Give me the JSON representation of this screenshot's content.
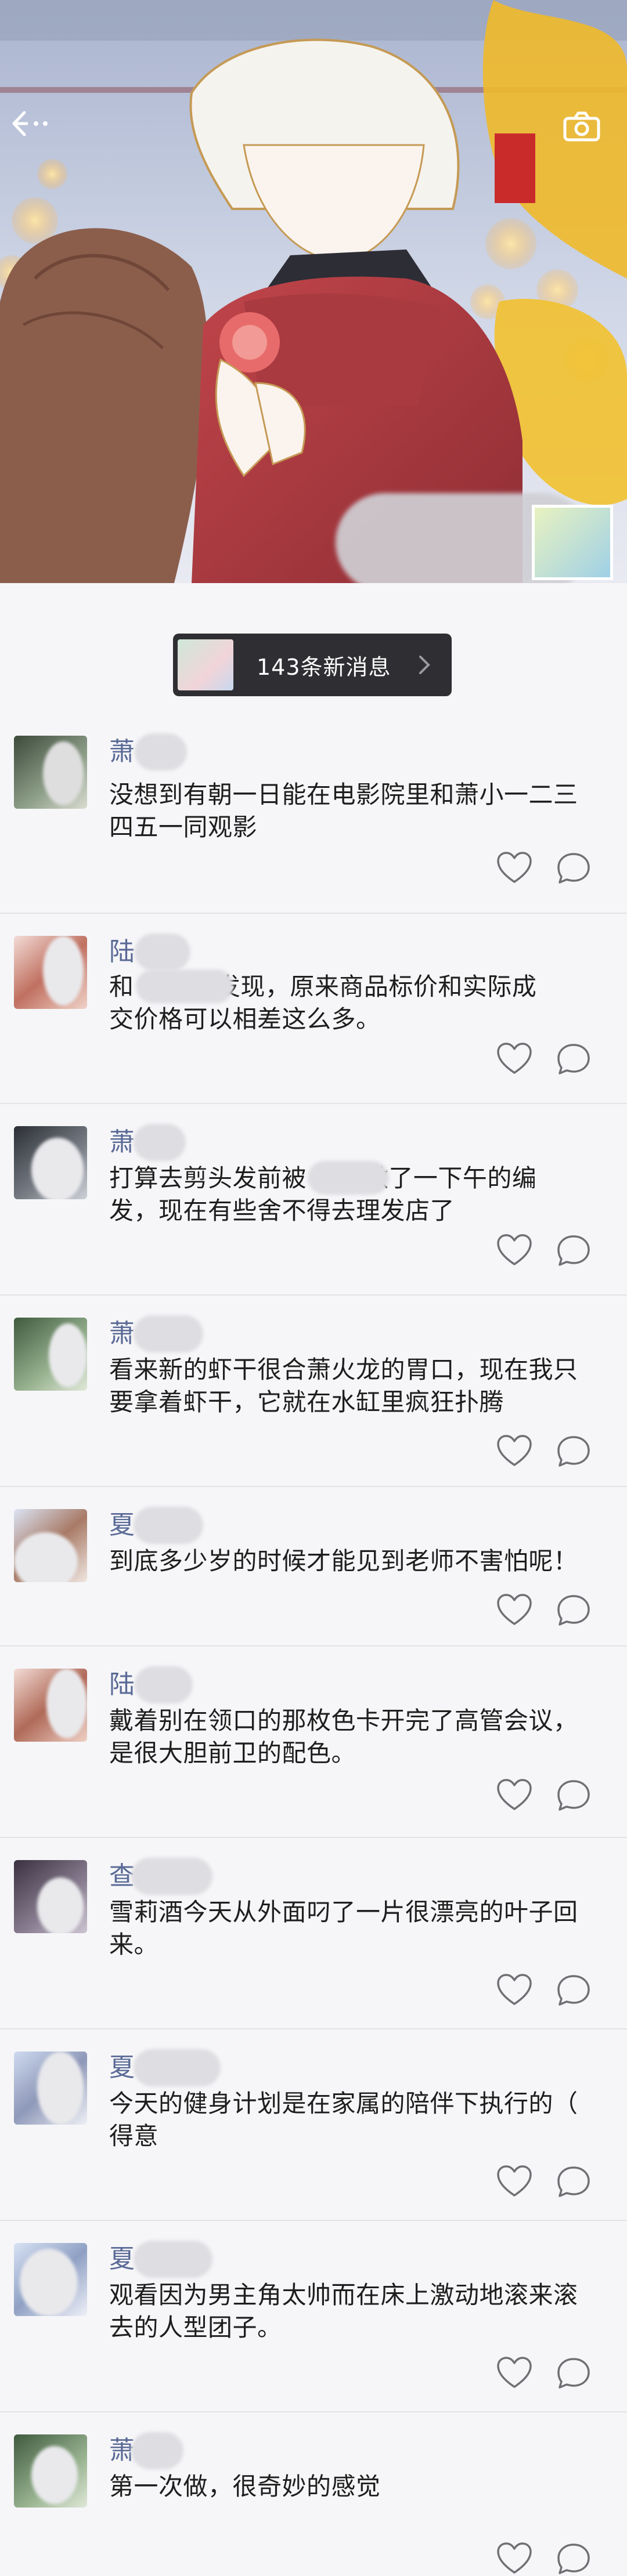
{
  "header": {
    "back_icon": "back-arrow-icon",
    "camera_icon": "camera-icon"
  },
  "new_messages": {
    "label": "143条新消息"
  },
  "posts": [
    {
      "name": "萧",
      "lines": [
        "没想到有朝一日能在电影院里和萧小一二三",
        "四五一同观影"
      ]
    },
    {
      "name": "陆",
      "lines": [
        "和          逛街新发现，原来商品标价和实际成",
        "交价格可以相差这么多。"
      ]
    },
    {
      "name": "萧",
      "lines": [
        "打算去剪头发前被          拉着做了一下午的编",
        "发，现在有些舍不得去理发店了"
      ]
    },
    {
      "name": "萧",
      "lines": [
        "看来新的虾干很合萧火龙的胃口，现在我只",
        "要拿着虾干，它就在水缸里疯狂扑腾"
      ]
    },
    {
      "name": "夏",
      "lines": [
        "到底多少岁的时候才能见到老师不害怕呢！"
      ]
    },
    {
      "name": "陆",
      "lines": [
        "戴着别在领口的那枚色卡开完了高管会议，",
        "是很大胆前卫的配色。"
      ]
    },
    {
      "name": "查",
      "lines": [
        "雪莉酒今天从外面叼了一片很漂亮的叶子回",
        "来。"
      ]
    },
    {
      "name": "夏",
      "lines": [
        "今天的健身计划是在家属的陪伴下执行的（",
        "得意"
      ]
    },
    {
      "name": "夏",
      "lines": [
        "观看因为男主角太帅而在床上激动地滚来滚",
        "去的人型团子。"
      ]
    },
    {
      "name": "萧",
      "lines": [
        "第一次做，很奇妙的感觉"
      ]
    }
  ],
  "icons": {
    "like": "heart-icon",
    "comment": "comment-icon"
  }
}
